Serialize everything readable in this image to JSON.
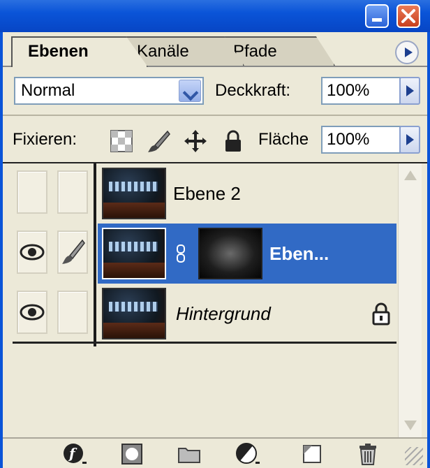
{
  "window": {
    "minimize_icon": "minimize-icon",
    "close_icon": "close-icon"
  },
  "tabs": [
    {
      "label": "Ebenen",
      "active": true
    },
    {
      "label": "Kanäle",
      "active": false
    },
    {
      "label": "Pfade",
      "active": false
    }
  ],
  "blend": {
    "mode": "Normal"
  },
  "opacity": {
    "label": "Deckkraft:",
    "value": "100%"
  },
  "lock": {
    "label": "Fixieren:",
    "icons": [
      "lock-transparency-icon",
      "lock-paint-icon",
      "lock-move-icon",
      "lock-all-icon"
    ]
  },
  "fill": {
    "label": "Fläche",
    "value": "100%"
  },
  "layers": [
    {
      "name": "Ebene 2",
      "visible": false,
      "linked": false,
      "selected": false
    },
    {
      "name": "Eben...",
      "visible": true,
      "brush": true,
      "selected": true,
      "has_mask": true
    },
    {
      "name": "Hintergrund",
      "visible": true,
      "selected": false,
      "locked": true
    }
  ],
  "toolbar": [
    "layer-style-icon",
    "layer-mask-icon",
    "new-group-icon",
    "adjustment-layer-icon",
    "new-layer-icon",
    "trash-icon"
  ],
  "colors": {
    "title_blue": "#0a54d8",
    "selection": "#316ac5",
    "panel": "#ece9d8"
  }
}
